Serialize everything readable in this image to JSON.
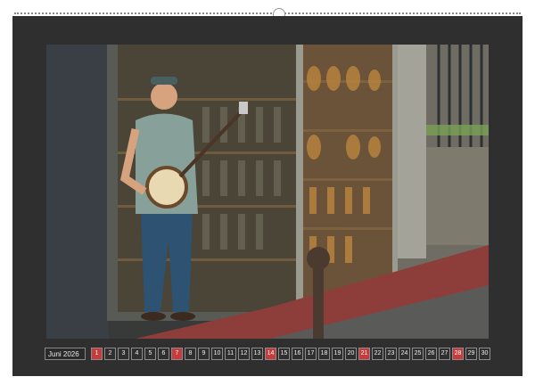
{
  "calendar": {
    "month_label": "Juni 2026",
    "days": [
      {
        "label": "1",
        "type": "we"
      },
      {
        "label": "2",
        "type": "w"
      },
      {
        "label": "3",
        "type": "w"
      },
      {
        "label": "4",
        "type": "w"
      },
      {
        "label": "5",
        "type": "w"
      },
      {
        "label": "6",
        "type": "w"
      },
      {
        "label": "7",
        "type": "we"
      },
      {
        "label": "8",
        "type": "w"
      },
      {
        "label": "9",
        "type": "w"
      },
      {
        "label": "10",
        "type": "w"
      },
      {
        "label": "11",
        "type": "w"
      },
      {
        "label": "12",
        "type": "w"
      },
      {
        "label": "13",
        "type": "w"
      },
      {
        "label": "14",
        "type": "we"
      },
      {
        "label": "15",
        "type": "w"
      },
      {
        "label": "16",
        "type": "w"
      },
      {
        "label": "17",
        "type": "w"
      },
      {
        "label": "18",
        "type": "w"
      },
      {
        "label": "19",
        "type": "w"
      },
      {
        "label": "20",
        "type": "w"
      },
      {
        "label": "21",
        "type": "we"
      },
      {
        "label": "22",
        "type": "w"
      },
      {
        "label": "23",
        "type": "w"
      },
      {
        "label": "24",
        "type": "w"
      },
      {
        "label": "25",
        "type": "w"
      },
      {
        "label": "26",
        "type": "w"
      },
      {
        "label": "27",
        "type": "w"
      },
      {
        "label": "28",
        "type": "we"
      },
      {
        "label": "29",
        "type": "w"
      },
      {
        "label": "30",
        "type": "w"
      }
    ]
  }
}
